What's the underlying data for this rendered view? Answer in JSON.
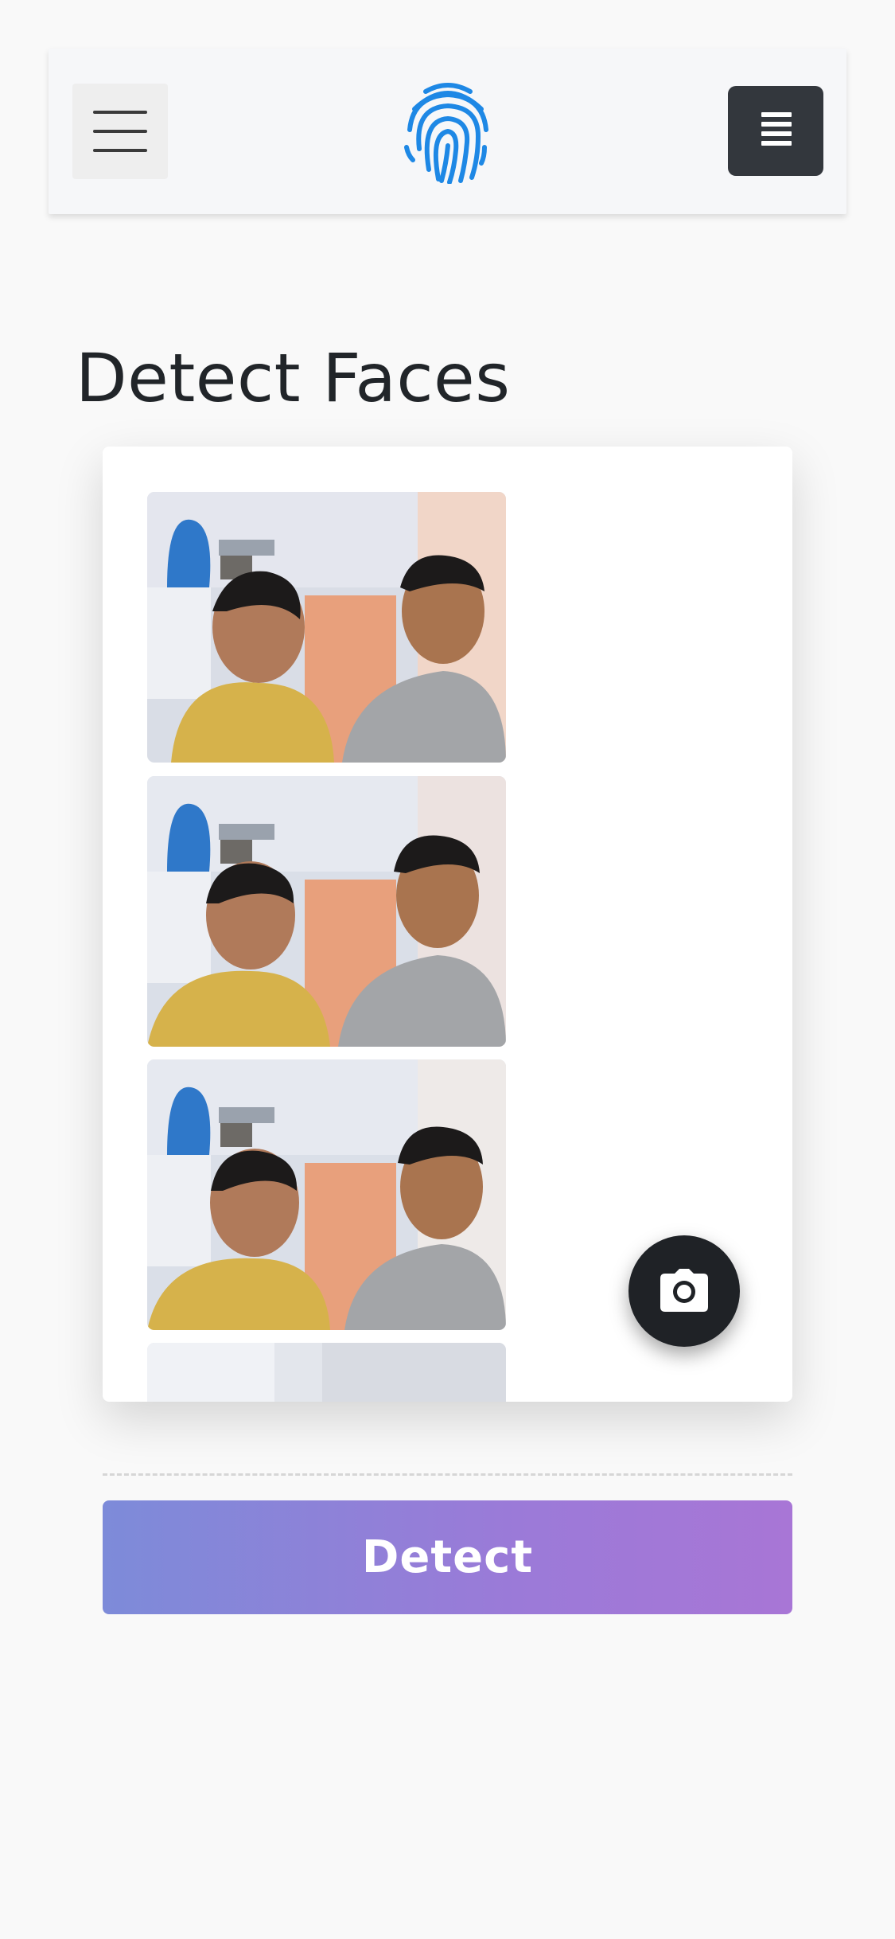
{
  "header": {
    "logo_icon": "fingerprint-icon",
    "menu_icon": "hamburger-icon",
    "right_icon": "list-icon",
    "logo_color": "#1e88e5"
  },
  "main": {
    "title": "Detect Faces",
    "photos": [
      {
        "alt": "Captured photo 1"
      },
      {
        "alt": "Captured photo 2"
      },
      {
        "alt": "Captured photo 3"
      },
      {
        "alt": "Captured photo 4"
      }
    ],
    "capture_icon": "camera-icon",
    "detect_label": "Detect"
  },
  "colors": {
    "accent_gradient_start": "#7d8bd9",
    "accent_gradient_end": "#a876d6",
    "dark_button": "#33373d",
    "fab": "#1f2226"
  }
}
